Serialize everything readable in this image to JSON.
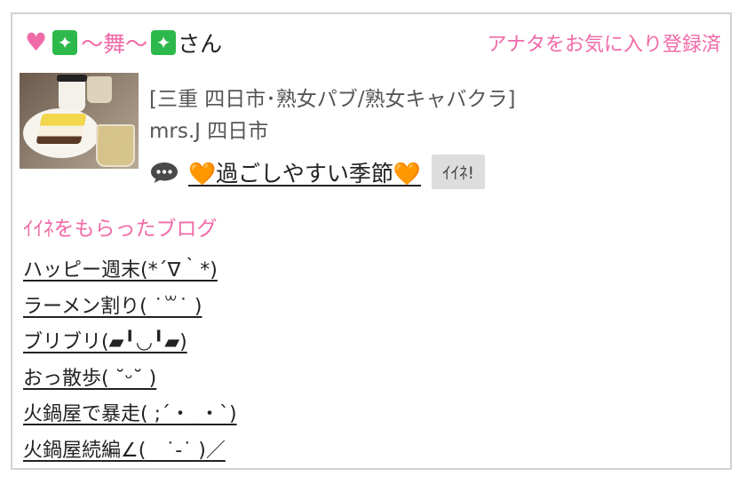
{
  "header": {
    "heart_glyph": "♥",
    "sparkle_glyph": "✦",
    "name_middle": "〜舞〜",
    "name_suffix": "さん",
    "favorite_status": "アナタをお気に入り登録済"
  },
  "profile": {
    "category": "[三重 四日市･熟女パブ/熟女キャバクラ]",
    "shop": "mrs.J 四日市",
    "blog_title_main": "過ごしやすい季節",
    "blog_heart_glyph": "🧡",
    "iine_button": "ｲｲﾈ!"
  },
  "liked_section": {
    "title": "ｲｲﾈをもらったブログ",
    "items": [
      "ハッピー週末(*´∇｀*)",
      "ラーメン割り( ˙꒳​˙ )",
      "ブリブリ(▰╹◡╹▰)",
      "おっ散歩( ˘ᵕ˘ )",
      "火鍋屋で暴走( ;´・_・`)",
      "火鍋屋続編∠(　˙-˙ )／"
    ]
  },
  "colors": {
    "accent_pink": "#f06aa8",
    "sparkle_green": "#2db84b",
    "heart_orange": "#f29020",
    "button_gray": "#dddddd",
    "border_gray": "#d2d2d2"
  },
  "icons": {
    "heart": "heart-icon",
    "sparkle": "sparkle-icon",
    "speech": "speech-bubble-icon"
  }
}
